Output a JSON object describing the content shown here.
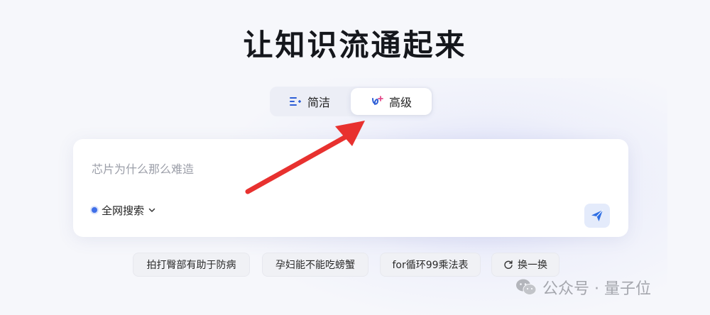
{
  "page": {
    "title": "让知识流通起来"
  },
  "mode_switch": {
    "simple_label": "简洁",
    "advanced_label": "高级",
    "selected": "高级",
    "simple_icon": "list-lines-icon",
    "advanced_icon": "ai-sparkle-icon"
  },
  "search": {
    "placeholder": "芯片为什么那么难造",
    "value": "",
    "scope_label": "全网搜索",
    "scope_icon": "chevron-down-icon",
    "send_icon": "paper-plane-icon"
  },
  "suggestions": {
    "items": [
      "拍打臀部有助于防病",
      "孕妇能不能吃螃蟹",
      "for循环99乘法表"
    ],
    "refresh_label": "换一换",
    "refresh_icon": "refresh-icon"
  },
  "annotation": {
    "arrow_color": "#e8312f",
    "arrow_target": "高级"
  },
  "watermark": {
    "text": "公众号 · 量子位",
    "icon": "wechat-icon"
  },
  "colors": {
    "accent": "#3f6fe8",
    "background": "#f6f7fb",
    "card": "#ffffff"
  }
}
